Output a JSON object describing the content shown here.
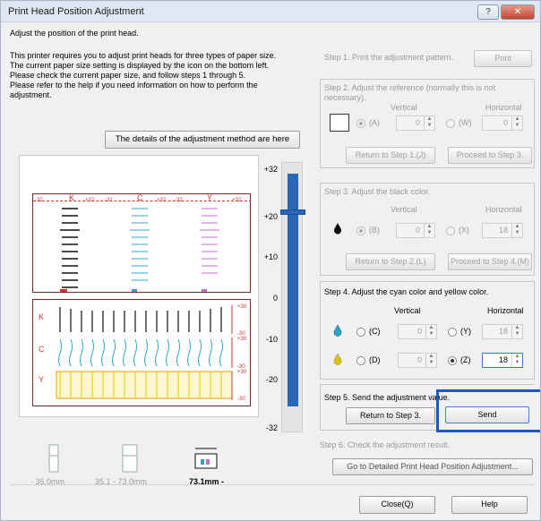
{
  "window": {
    "title": "Print Head Position Adjustment",
    "help_glyph": "?",
    "close_glyph": "✕"
  },
  "intro": {
    "heading": "Adjust the position of the print head.",
    "lines": [
      "This printer requires you to adjust print heads for three types of paper size.",
      "The current paper size setting is displayed by the icon on the bottom left.",
      "Please check the current paper size, and follow steps 1 through 5.",
      "Please refer to the help if you need information on how to perform the",
      "adjustment."
    ],
    "details_button": "The details of the adjustment method are here"
  },
  "pattern": {
    "top_labels": [
      "K",
      "C",
      "Y"
    ],
    "top_scale_labels": [
      "-32",
      "+32",
      "-32",
      "+32",
      "-32",
      "+32"
    ],
    "bottom_row_labels": [
      "K",
      "C",
      "Y"
    ],
    "right_labels": [
      "+30",
      "-30",
      "+30",
      "-30",
      "+30",
      "-30"
    ]
  },
  "slider": {
    "ticks": [
      "+32",
      "+20",
      "+10",
      "0",
      "-10",
      "-20",
      "-32"
    ],
    "value": 22,
    "min": -32,
    "max": 32
  },
  "paper": {
    "options": [
      "- 35.0mm",
      "35.1 - 73.0mm",
      "73.1mm -"
    ],
    "selected": 2
  },
  "steps": {
    "s1": {
      "label": "Step 1. Print the adjustment pattern.",
      "button": "Print"
    },
    "s2": {
      "label": "Step 2. Adjust the reference (normally this is not necessary).",
      "vertical": "Vertical",
      "horizontal": "Horizontal",
      "radio_a": "(A)",
      "radio_w": "(W)",
      "val_a": "0",
      "val_w": "0",
      "back": "Return to Step 1.(J)",
      "next": "Proceed to Step 3."
    },
    "s3": {
      "label": "Step 3. Adjust the black color.",
      "vertical": "Vertical",
      "horizontal": "Horizontal",
      "radio_b": "(B)",
      "radio_x": "(X)",
      "val_b": "0",
      "val_x": "18",
      "back": "Return to Step 2.(L)",
      "next": "Proceed to Step 4.(M)"
    },
    "s4": {
      "label": "Step 4. Adjust the cyan color and yellow color.",
      "vertical": "Vertical",
      "horizontal": "Horizontal",
      "radio_c": "(C)",
      "radio_y": "(Y)",
      "radio_d": "(D)",
      "radio_z": "(Z)",
      "val_c": "0",
      "val_y": "18",
      "val_d": "0",
      "val_z": "18"
    },
    "s5": {
      "label": "Step 5. Send the adjustment value.",
      "back": "Return to Step 3.",
      "send": "Send"
    },
    "s6": {
      "label": "Step 6. Check the adjustment result.",
      "button": "Go to Detailed Print Head Position Adjustment..."
    }
  },
  "footer": {
    "close": "Close(Q)",
    "help": "Help"
  },
  "colors": {
    "accent": "#2a66b8",
    "highlight": "#1759c6",
    "black_ink": "#111111",
    "cyan_ink": "#2aa6c9",
    "yellow_ink": "#e1c400"
  }
}
